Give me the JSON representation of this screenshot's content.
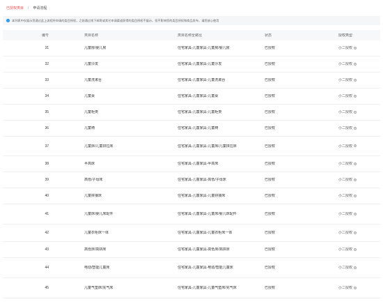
{
  "breadcrumb": {
    "first": "已授权类目",
    "separator": "/",
    "second": "申请流程"
  },
  "notice": {
    "icon": "info-icon",
    "text": "本列表中仅展示您通过此上流程所申请的类目授权，之前通过线下邮寄或其它申请渠道获得的类目授权不展示，但不影响您的类目授权和商品发布，请您放心使用"
  },
  "table": {
    "headers": [
      "编号",
      "类目名称",
      "类目名称全路径",
      "状态",
      "授权类型"
    ],
    "rows": [
      {
        "id": "31",
        "name": "儿童房/婴儿房",
        "path": "住宅家具-儿童家具-儿童房/婴儿房",
        "status": "已授权",
        "type": "小二授权"
      },
      {
        "id": "32",
        "name": "儿童沙发",
        "path": "住宅家具-儿童家具-儿童沙发",
        "status": "已授权",
        "type": "小二授权"
      },
      {
        "id": "33",
        "name": "儿童洗漱台",
        "path": "住宅家具-儿童家具-儿童洗漱台",
        "status": "已授权",
        "type": "小二授权"
      },
      {
        "id": "34",
        "name": "儿童桌",
        "path": "住宅家具-儿童家具-儿童桌",
        "status": "已授权",
        "type": "小二授权"
      },
      {
        "id": "35",
        "name": "儿童柜类",
        "path": "住宅家具-儿童家具-儿童柜类",
        "status": "已授权",
        "type": "小二授权"
      },
      {
        "id": "36",
        "name": "儿童椅",
        "path": "住宅家具-儿童家具-儿童椅",
        "status": "已授权",
        "type": "小二授权"
      },
      {
        "id": "37",
        "name": "儿童床/儿童拼拉床",
        "path": "住宅家具-儿童家具-儿童床/儿童拼拉床",
        "status": "已授权",
        "type": "小二授权"
      },
      {
        "id": "38",
        "name": "半高床",
        "path": "住宅家具-儿童家具-半高床",
        "status": "已授权",
        "type": "小二授权"
      },
      {
        "id": "39",
        "name": "高低/子母床",
        "path": "住宅家具-儿童家具-高低/子母床",
        "status": "已授权",
        "type": "小二授权"
      },
      {
        "id": "40",
        "name": "儿童拼接床",
        "path": "住宅家具-儿童家具-儿童拼接床",
        "status": "已授权",
        "type": "小二授权"
      },
      {
        "id": "41",
        "name": "儿童床/婴儿床配件",
        "path": "住宅家具-儿童家具-儿童床/婴儿床配件",
        "status": "已授权",
        "type": "小二授权"
      },
      {
        "id": "42",
        "name": "儿童衣柜床一体",
        "path": "住宅家具-儿童家具-儿童衣柜床一体",
        "status": "已授权",
        "type": "小二授权"
      },
      {
        "id": "43",
        "name": "高低床/高拼床",
        "path": "住宅家具-儿童家具-高低床/高拼床",
        "status": "已授权",
        "type": "小二授权"
      },
      {
        "id": "44",
        "name": "电动/智能儿童床",
        "path": "住宅家具-儿童家具-电动/智能儿童床",
        "status": "已授权",
        "type": "小二授权"
      },
      {
        "id": "45",
        "name": "儿童气垫床/充气床",
        "path": "住宅家具-儿童家具-儿童气垫床/充气床",
        "status": "已授权",
        "type": "小二授权"
      }
    ]
  }
}
